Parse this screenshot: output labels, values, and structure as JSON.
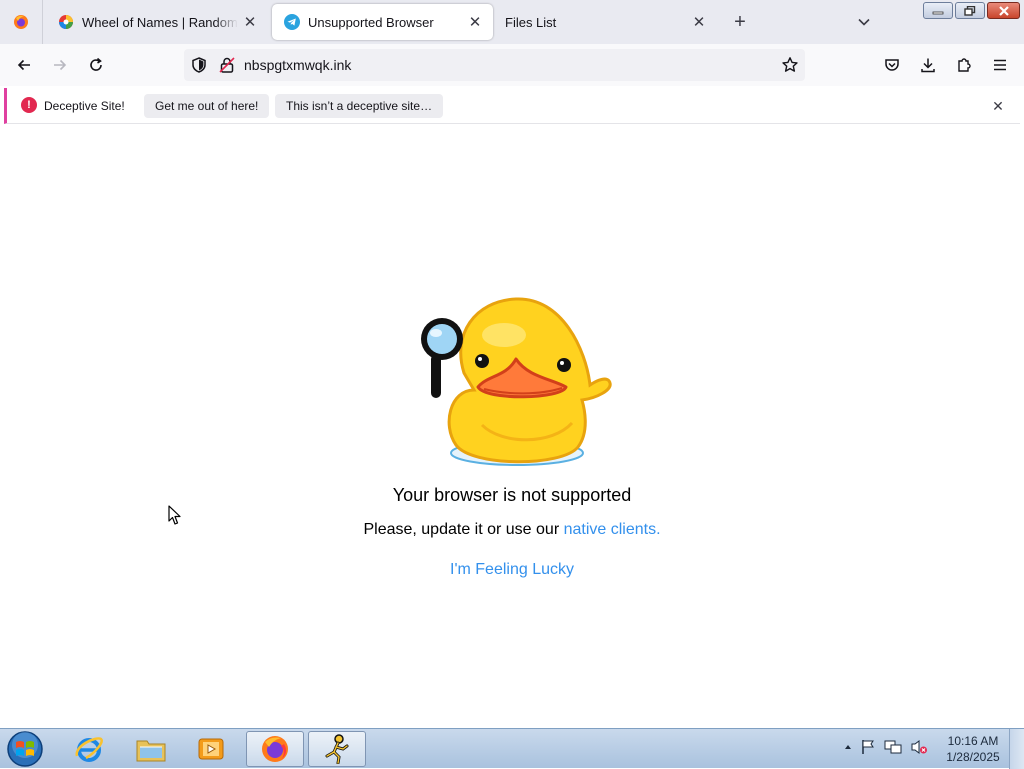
{
  "tabs": [
    {
      "title": "Wheel of Names | Random name picker",
      "close": "✕",
      "active": false
    },
    {
      "title": "Unsupported Browser",
      "close": "✕",
      "active": true
    },
    {
      "title": "Files List",
      "close": "✕",
      "active": false
    }
  ],
  "tabstrip": {
    "new_tab": "+"
  },
  "navbar": {
    "url": "nbspgtxmwqk.ink"
  },
  "notification": {
    "icon": "!",
    "message": "Deceptive Site!",
    "button_primary": "Get me out of here!",
    "button_secondary": "This isn’t a deceptive site…",
    "close": "✕"
  },
  "page": {
    "headline": "Your browser is not supported",
    "subline_text": "Please, update it or use our ",
    "subline_link": "native clients.",
    "lucky_link": "I'm Feeling Lucky"
  },
  "taskbar": {
    "time": "10:16 AM",
    "date": "1/28/2025"
  },
  "colors": {
    "accent_link": "#3390ec",
    "warning": "#e22850",
    "notification_border": "#e040a0"
  },
  "icons": [
    "firefox-icon",
    "telegram-icon",
    "wheel-icon",
    "back-icon",
    "forward-icon",
    "reload-icon",
    "shield-icon",
    "lock-icon",
    "star-icon",
    "pocket-icon",
    "download-icon",
    "extensions-icon",
    "menu-icon",
    "windows-start-icon",
    "ie-icon",
    "explorer-icon",
    "media-player-icon",
    "aim-icon"
  ]
}
